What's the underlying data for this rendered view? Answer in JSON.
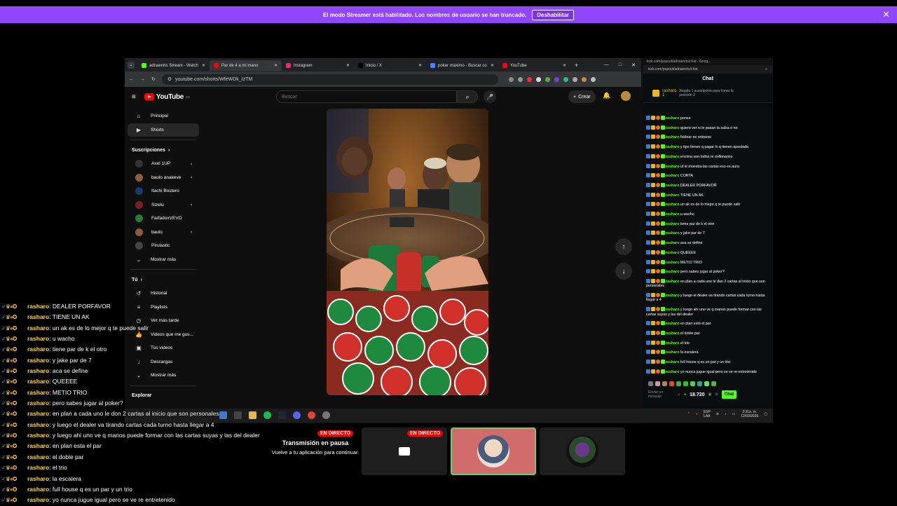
{
  "banner": {
    "text": "El modo Streamer está habilitado. Los nombres de usuario se han truncado.",
    "button": "Deshabilitar",
    "close": "✕"
  },
  "browser": {
    "tabs": [
      {
        "label": "adnaenrts Stream - Watch",
        "color": "#53fc18"
      },
      {
        "label": "Par de 4 a mi mano",
        "color": "#ff0000"
      },
      {
        "label": "Instagram",
        "color": "#e1306c"
      },
      {
        "label": "Inicio / X",
        "color": "#000000"
      },
      {
        "label": "poker maximo - Buscar co",
        "color": "#4285f4"
      },
      {
        "label": "YouTube",
        "color": "#ff0000"
      }
    ],
    "url": "youtube.com/shorts/WfeWDk_IzTM",
    "window_controls": [
      "—",
      "□",
      "✕"
    ]
  },
  "youtube": {
    "logo": "YouTube",
    "country": "CO",
    "search_placeholder": "Buscar",
    "create": "Crear",
    "nav": [
      {
        "label": "Principal",
        "icon": "⌂"
      },
      {
        "label": "Shorts",
        "icon": "▶"
      }
    ],
    "subs_title": "Suscripciones",
    "subs": [
      {
        "label": "Axel 1UP",
        "color": "#333",
        "dot": true
      },
      {
        "label": "baulo anakeve",
        "color": "#8b5e3c",
        "dot": true
      },
      {
        "label": "Itachi Bostero",
        "color": "#1a3a6a",
        "dot": false
      },
      {
        "label": "Sizelu",
        "color": "#7a2020",
        "dot": true
      },
      {
        "label": "FarfadoxVEVO",
        "color": "#2a7a3a",
        "dot": false
      },
      {
        "label": "baulo",
        "color": "#8b5e3c",
        "dot": true
      },
      {
        "label": "Pirulastic",
        "color": "#444",
        "dot": false
      }
    ],
    "more1": "Mostrar más",
    "you_title": "Tú",
    "you": [
      {
        "label": "Historial",
        "icon": "↺"
      },
      {
        "label": "Playlists",
        "icon": "≡"
      },
      {
        "label": "Ver más tarde",
        "icon": "◷"
      },
      {
        "label": "Videos que me gus...",
        "icon": "👍"
      },
      {
        "label": "Tus videos",
        "icon": "▣"
      },
      {
        "label": "Descargas",
        "icon": "↓"
      }
    ],
    "more2": "Mostrar más",
    "explore": "Explorar"
  },
  "kick": {
    "title_bar": "kick.com/popout/adnaenrts/chat - Goog...",
    "url": "kick.com/popout/adnaenrts/chat",
    "header": "Chat",
    "pinned_user": "rasharo",
    "pinned_level": "1",
    "pinned_text": "Regalo 1 suscripción para tomar la posición 2",
    "messages": [
      {
        "user": "rasharo",
        "text": "ponee"
      },
      {
        "user": "rasharo",
        "text": "quiero ver si le pasan la salsa o no"
      },
      {
        "user": "rasharo",
        "text": "foldear es retirarse"
      },
      {
        "user": "rasharo",
        "text": "y tipo tienen q pagar lo q tienen apostado"
      },
      {
        "user": "rasharo",
        "text": "encima son todos re millonarios"
      },
      {
        "user": "rasharo",
        "text": "uf le muestra las cartas eso es aura"
      },
      {
        "user": "rasharo",
        "text": "CORTA"
      },
      {
        "user": "rasharo",
        "text": "DEALER PORFAVOR"
      },
      {
        "user": "rasharo",
        "text": "TIENE UN AK"
      },
      {
        "user": "rasharo",
        "text": "un ak es de lo mejor q te puede salir"
      },
      {
        "user": "rasharo",
        "text": "u wacho"
      },
      {
        "user": "rasharo",
        "text": "tiene par de k el otro"
      },
      {
        "user": "rasharo",
        "text": "y jake par de 7"
      },
      {
        "user": "rasharo",
        "text": "aca se define"
      },
      {
        "user": "rasharo",
        "text": "QUEEEE"
      },
      {
        "user": "rasharo",
        "text": "METIO TRIO"
      },
      {
        "user": "rasharo",
        "text": "pero sabes jugar al poker?"
      },
      {
        "user": "rasharo",
        "text": "en plan a cada uno le dan 2 cartas al inicio que son personales"
      },
      {
        "user": "rasharo",
        "text": "y luego el dealer va tirando cartas cada turno hasta llegar a 4"
      },
      {
        "user": "rasharo",
        "text": "y luego ahi uno ve q manos puede formar con las cartas suyas y las del dealer"
      },
      {
        "user": "rasharo",
        "text": "en plan esta el par"
      },
      {
        "user": "rasharo",
        "text": "el doble par"
      },
      {
        "user": "rasharo",
        "text": "el trio"
      },
      {
        "user": "rasharo",
        "text": "la escalera"
      },
      {
        "user": "rasharo",
        "text": "full house q es un par y un trio"
      },
      {
        "user": "rasharo",
        "text": "yo nunca jugue igual pero se ve re entretenido"
      }
    ],
    "input_placeholder": "Enviar un mensaje",
    "count": "18.720",
    "chat_button": "Chat"
  },
  "taskbar": {
    "lang": "ESP",
    "lang2": "LAA",
    "time": "2:31a. m.",
    "date": "12/03/2026"
  },
  "overlay_chat": [
    {
      "user": "rasharo",
      "text": "DEALER PORFAVOR"
    },
    {
      "user": "rasharo",
      "text": "TIENE UN AK"
    },
    {
      "user": "rasharo",
      "text": "un ak es de lo mejor q te puede salir"
    },
    {
      "user": "rasharo",
      "text": "u wacho"
    },
    {
      "user": "rasharo",
      "text": "tiene par de k el otro"
    },
    {
      "user": "rasharo",
      "text": "y jake par de 7"
    },
    {
      "user": "rasharo",
      "text": "aca se define"
    },
    {
      "user": "rasharo",
      "text": "QUEEEE"
    },
    {
      "user": "rasharo",
      "text": "METIO TRIO"
    },
    {
      "user": "rasharo",
      "text": "pero sabes jugar al poker?"
    },
    {
      "user": "rasharo",
      "text": "en plan a cada uno le don 2 cartas al inicio que son personales"
    },
    {
      "user": "rasharo",
      "text": "y luego el dealer va tirando cartas cada turno hasta llegar a 4"
    },
    {
      "user": "rasharo",
      "text": "y luego ahi uno ve q manos puede formar con las cartas suyas y las del dealer"
    },
    {
      "user": "rasharo",
      "text": "en plan esta el par"
    },
    {
      "user": "rasharo",
      "text": "el doble par"
    },
    {
      "user": "rasharo",
      "text": "el trio"
    },
    {
      "user": "rasharo",
      "text": "la escalera"
    },
    {
      "user": "rasharo",
      "text": "full house q es un par y un trio"
    },
    {
      "user": "rasharo",
      "text": "yo nunca jugue igual pero se ve re entretenido"
    }
  ],
  "meet": {
    "live1": "EN DIRECTO",
    "live2": "EN DIRECTO",
    "paused_title": "Transmisión en pausa",
    "paused_sub": "Vuelve a tu aplicación para continuar."
  }
}
